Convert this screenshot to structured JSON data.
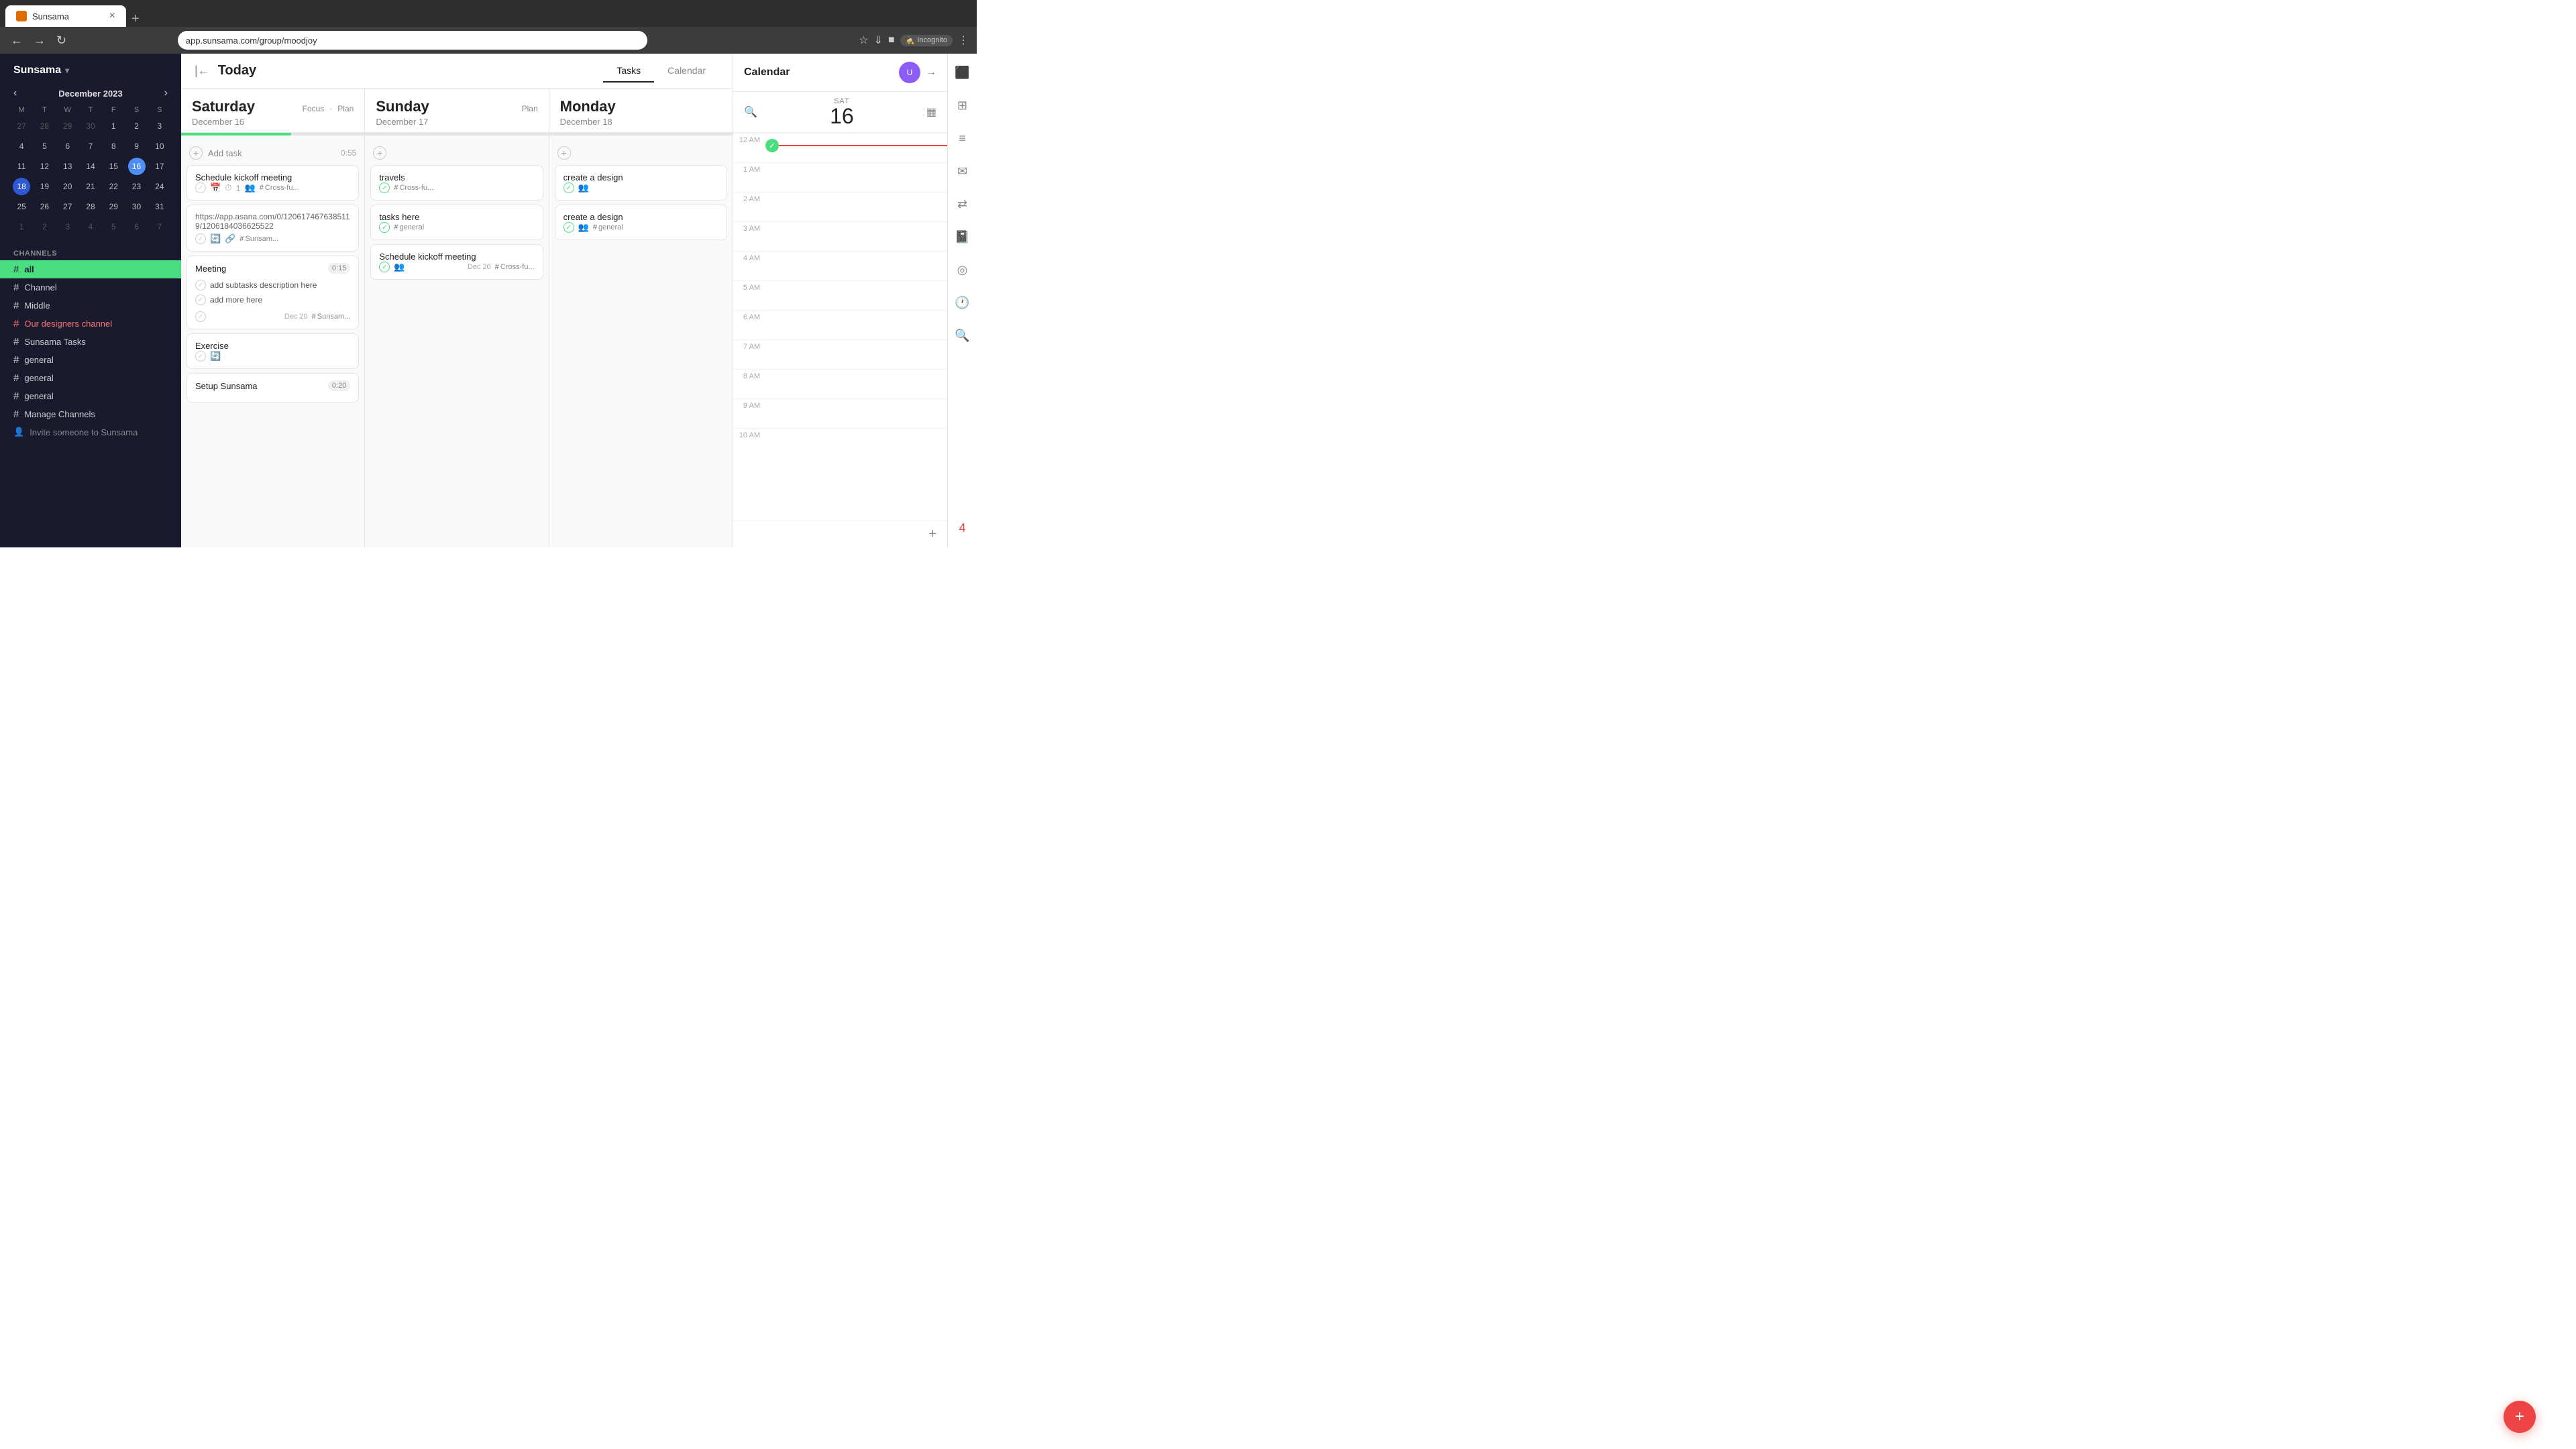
{
  "browser": {
    "tab_title": "Sunsama",
    "url": "app.sunsama.com/group/moodjoy",
    "new_tab_label": "+",
    "incognito_label": "Incognito"
  },
  "sidebar": {
    "title": "Sunsama",
    "calendar": {
      "month_year": "December 2023",
      "day_headers": [
        "M",
        "T",
        "W",
        "T",
        "F",
        "S",
        "S"
      ],
      "weeks": [
        [
          {
            "day": "27",
            "other": true
          },
          {
            "day": "28",
            "other": true
          },
          {
            "day": "29",
            "other": true
          },
          {
            "day": "30",
            "other": true
          },
          {
            "day": "1",
            "other": false
          },
          {
            "day": "2",
            "other": false
          },
          {
            "day": "3",
            "other": false
          }
        ],
        [
          {
            "day": "4",
            "other": false
          },
          {
            "day": "5",
            "other": false
          },
          {
            "day": "6",
            "other": false
          },
          {
            "day": "7",
            "other": false
          },
          {
            "day": "8",
            "other": false
          },
          {
            "day": "9",
            "other": false
          },
          {
            "day": "10",
            "other": false
          }
        ],
        [
          {
            "day": "11",
            "other": false
          },
          {
            "day": "12",
            "other": false
          },
          {
            "day": "13",
            "other": false
          },
          {
            "day": "14",
            "other": false
          },
          {
            "day": "15",
            "other": false
          },
          {
            "day": "16",
            "other": false,
            "today": false
          },
          {
            "day": "17",
            "other": false
          }
        ],
        [
          {
            "day": "18",
            "other": false,
            "selected": true
          },
          {
            "day": "19",
            "other": false
          },
          {
            "day": "20",
            "other": false
          },
          {
            "day": "21",
            "other": false
          },
          {
            "day": "22",
            "other": false
          },
          {
            "day": "23",
            "other": false
          },
          {
            "day": "24",
            "other": false
          }
        ],
        [
          {
            "day": "25",
            "other": false
          },
          {
            "day": "26",
            "other": false
          },
          {
            "day": "27",
            "other": false
          },
          {
            "day": "28",
            "other": false
          },
          {
            "day": "29",
            "other": false
          },
          {
            "day": "30",
            "other": false
          },
          {
            "day": "31",
            "other": false
          }
        ],
        [
          {
            "day": "1",
            "other": true
          },
          {
            "day": "2",
            "other": true
          },
          {
            "day": "3",
            "other": true
          },
          {
            "day": "4",
            "other": true
          },
          {
            "day": "5",
            "other": true
          },
          {
            "day": "6",
            "other": true
          },
          {
            "day": "7",
            "other": true
          }
        ]
      ]
    },
    "channels_label": "CHANNELS",
    "channels": [
      {
        "id": "all",
        "label": "all",
        "active": true
      },
      {
        "id": "channel",
        "label": "Channel"
      },
      {
        "id": "middle",
        "label": "Middle"
      },
      {
        "id": "designers",
        "label": "Our designers channel",
        "special": true
      },
      {
        "id": "sunsama-tasks",
        "label": "Sunsama Tasks"
      },
      {
        "id": "general1",
        "label": "general"
      },
      {
        "id": "general2",
        "label": "general"
      },
      {
        "id": "general3",
        "label": "general"
      },
      {
        "id": "manage",
        "label": "Manage Channels"
      }
    ],
    "invite_label": "Invite someone to Sunsama"
  },
  "main_header": {
    "today_label": "Today",
    "tabs": [
      {
        "id": "tasks",
        "label": "Tasks",
        "active": true
      },
      {
        "id": "calendar",
        "label": "Calendar",
        "active": false
      }
    ]
  },
  "columns": [
    {
      "id": "saturday",
      "day_name": "Saturday",
      "date": "December 16",
      "actions": [
        "Focus",
        "Plan"
      ],
      "progress": 60,
      "add_task_label": "Add task",
      "add_task_time": "0:55",
      "tasks": [
        {
          "id": "task1",
          "title": "Schedule kickoff meeting",
          "footer_items": [
            "check",
            "calendar",
            "clock",
            "users",
            "tag:Cross-fu..."
          ]
        },
        {
          "id": "task2",
          "type": "url",
          "url": "https://app.asana.com/0/1206174676385119/1206184036625522",
          "footer_items": [
            "check",
            "sync",
            "link",
            "tag:Sunsam..."
          ]
        },
        {
          "id": "task3",
          "title": "Meeting",
          "time": "0:15",
          "subtasks": [
            "add subtasks description here",
            "add more here"
          ],
          "due": "Dec 20",
          "tag": "Sunsam..."
        },
        {
          "id": "task4",
          "title": "Exercise",
          "footer_items": [
            "check",
            "sync"
          ]
        },
        {
          "id": "task5",
          "title": "Setup Sunsama",
          "time": "0:20"
        }
      ]
    },
    {
      "id": "sunday",
      "day_name": "Sunday",
      "date": "December 17",
      "actions": [
        "Plan"
      ],
      "progress": 0,
      "tasks": [
        {
          "id": "stask1",
          "title": "travels",
          "footer_items": [
            "check-done",
            "tag:Cross-fu..."
          ]
        },
        {
          "id": "stask2",
          "title": "tasks here",
          "footer_items": [
            "check-done",
            "tag:general"
          ]
        },
        {
          "id": "stask3",
          "title": "Schedule kickoff meeting",
          "check_done": true,
          "avatar": true,
          "due": "Dec 20",
          "tag": "Cross-fu..."
        }
      ]
    },
    {
      "id": "monday",
      "day_name": "Monday",
      "date": "December 18",
      "actions": [],
      "progress": 0,
      "tasks": [
        {
          "id": "mtask1",
          "title": "create a design",
          "footer_items": [
            "check-done",
            "users"
          ]
        },
        {
          "id": "mtask2",
          "title": "create a design",
          "footer_items": [
            "check-done",
            "users",
            "tag:general"
          ]
        }
      ]
    }
  ],
  "right_panel": {
    "title": "Calendar",
    "selected_day_label": "SAT",
    "selected_day_num": "16",
    "time_labels": [
      "12 AM",
      "1 AM",
      "2 AM",
      "3 AM",
      "4 AM",
      "5 AM",
      "6 AM",
      "7 AM",
      "8 AM",
      "9 AM",
      "10 AM"
    ]
  },
  "fab": {
    "label": "+"
  }
}
